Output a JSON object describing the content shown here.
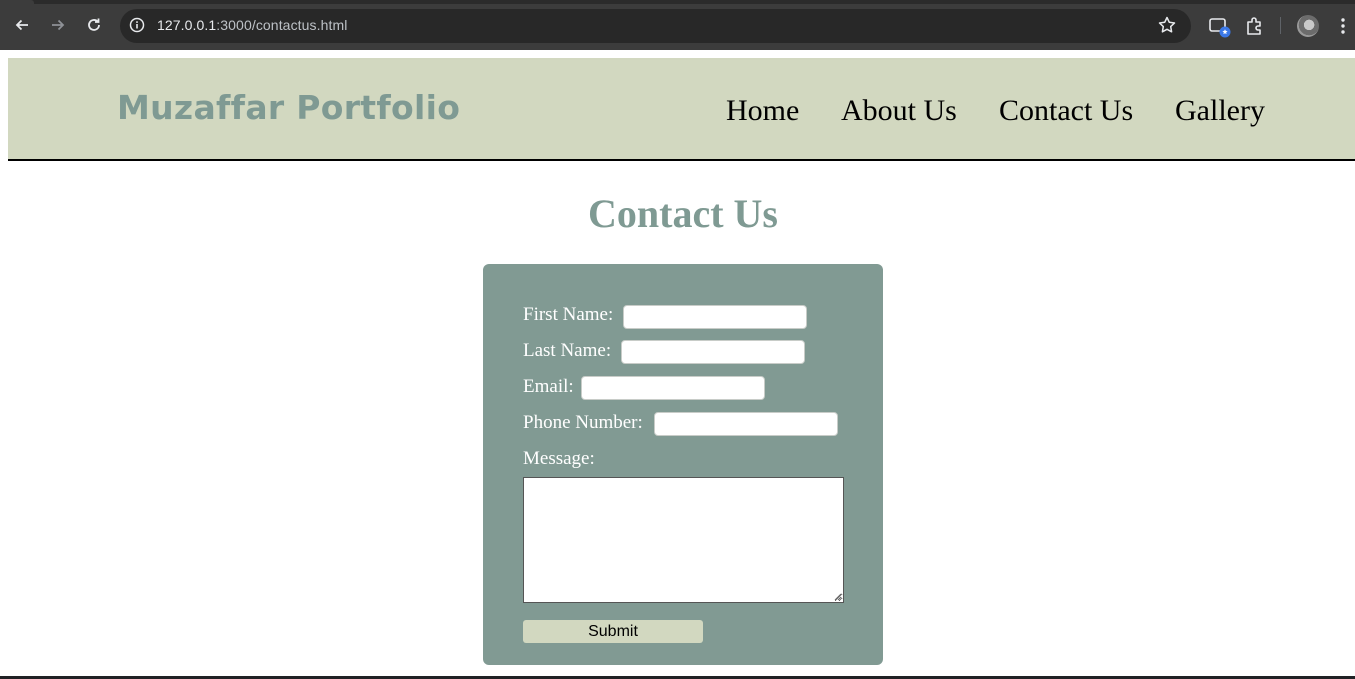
{
  "browser": {
    "url_host": "127.0.0.1",
    "url_path": ":3000/contactus.html",
    "icons": [
      "back-arrow-icon",
      "forward-arrow-icon",
      "reload-icon",
      "site-info-icon",
      "bookmark-star-icon",
      "tab-search-icon",
      "extensions-puzzle-icon",
      "profile-avatar",
      "kebab-menu-icon"
    ]
  },
  "site": {
    "logo": "Muzaffar Portfolio",
    "nav": {
      "home": "Home",
      "about": "About Us",
      "contact": "Contact Us",
      "gallery": "Gallery"
    }
  },
  "page": {
    "title": "Contact Us"
  },
  "form": {
    "first_name_label": "First Name:",
    "first_name_value": "",
    "last_name_label": "Last Name:",
    "last_name_value": "",
    "email_label": "Email:",
    "email_value": "",
    "phone_label": "Phone Number:",
    "phone_value": "",
    "message_label": "Message:",
    "message_value": "",
    "submit_label": "Submit"
  },
  "colors": {
    "header_bg": "#d2d8c0",
    "accent": "#7f9a93",
    "card_bg": "#819a93",
    "button_bg": "#d2d8c0"
  }
}
